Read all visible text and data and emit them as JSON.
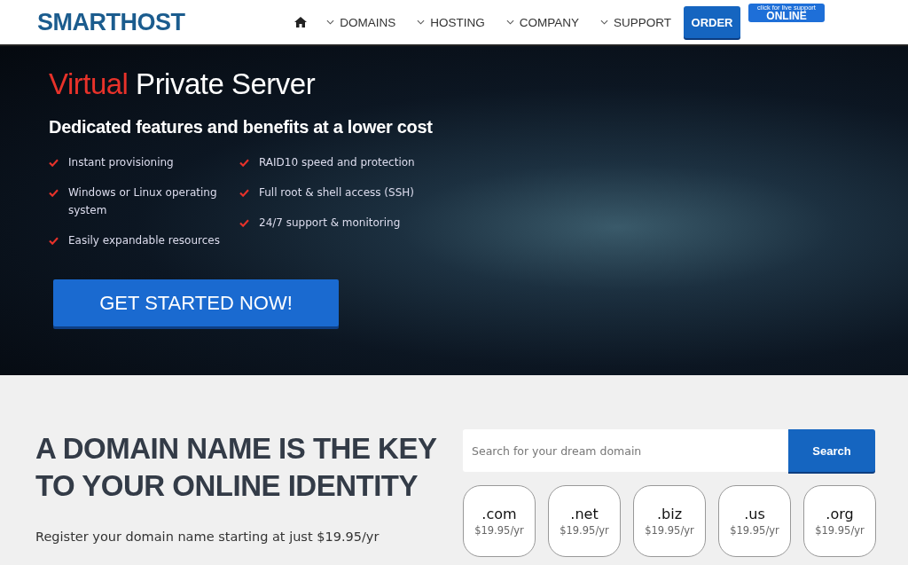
{
  "header": {
    "logo": "SMARTHOST",
    "nav": [
      {
        "label": "DOMAINS"
      },
      {
        "label": "HOSTING"
      },
      {
        "label": "COMPANY"
      },
      {
        "label": "SUPPORT"
      }
    ],
    "order_button": "ORDER",
    "live_support": {
      "caption": "click for live support",
      "status": "ONLINE"
    }
  },
  "hero": {
    "title_highlight": "Virtual",
    "title_rest": "Private Server",
    "subtitle": "Dedicated features and benefits at a lower cost",
    "feature_columns": [
      [
        "Instant provisioning",
        "Windows or Linux operating system",
        "Easily expandable resources"
      ],
      [
        "RAID10 speed and protection",
        "Full root & shell access (SSH)",
        "24/7 support & monitoring"
      ]
    ],
    "cta": "GET STARTED NOW!"
  },
  "domain": {
    "heading": "A DOMAIN NAME IS THE KEY TO YOUR ONLINE IDENTITY",
    "text": "Register your domain name starting at just $19.95/yr",
    "search": {
      "placeholder": "Search for your dream domain",
      "button": "Search"
    },
    "tlds": [
      {
        "name": ".com",
        "price": "$19.95/yr"
      },
      {
        "name": ".net",
        "price": "$19.95/yr"
      },
      {
        "name": ".biz",
        "price": "$19.95/yr"
      },
      {
        "name": ".us",
        "price": "$19.95/yr"
      },
      {
        "name": ".org",
        "price": "$19.95/yr"
      }
    ]
  }
}
